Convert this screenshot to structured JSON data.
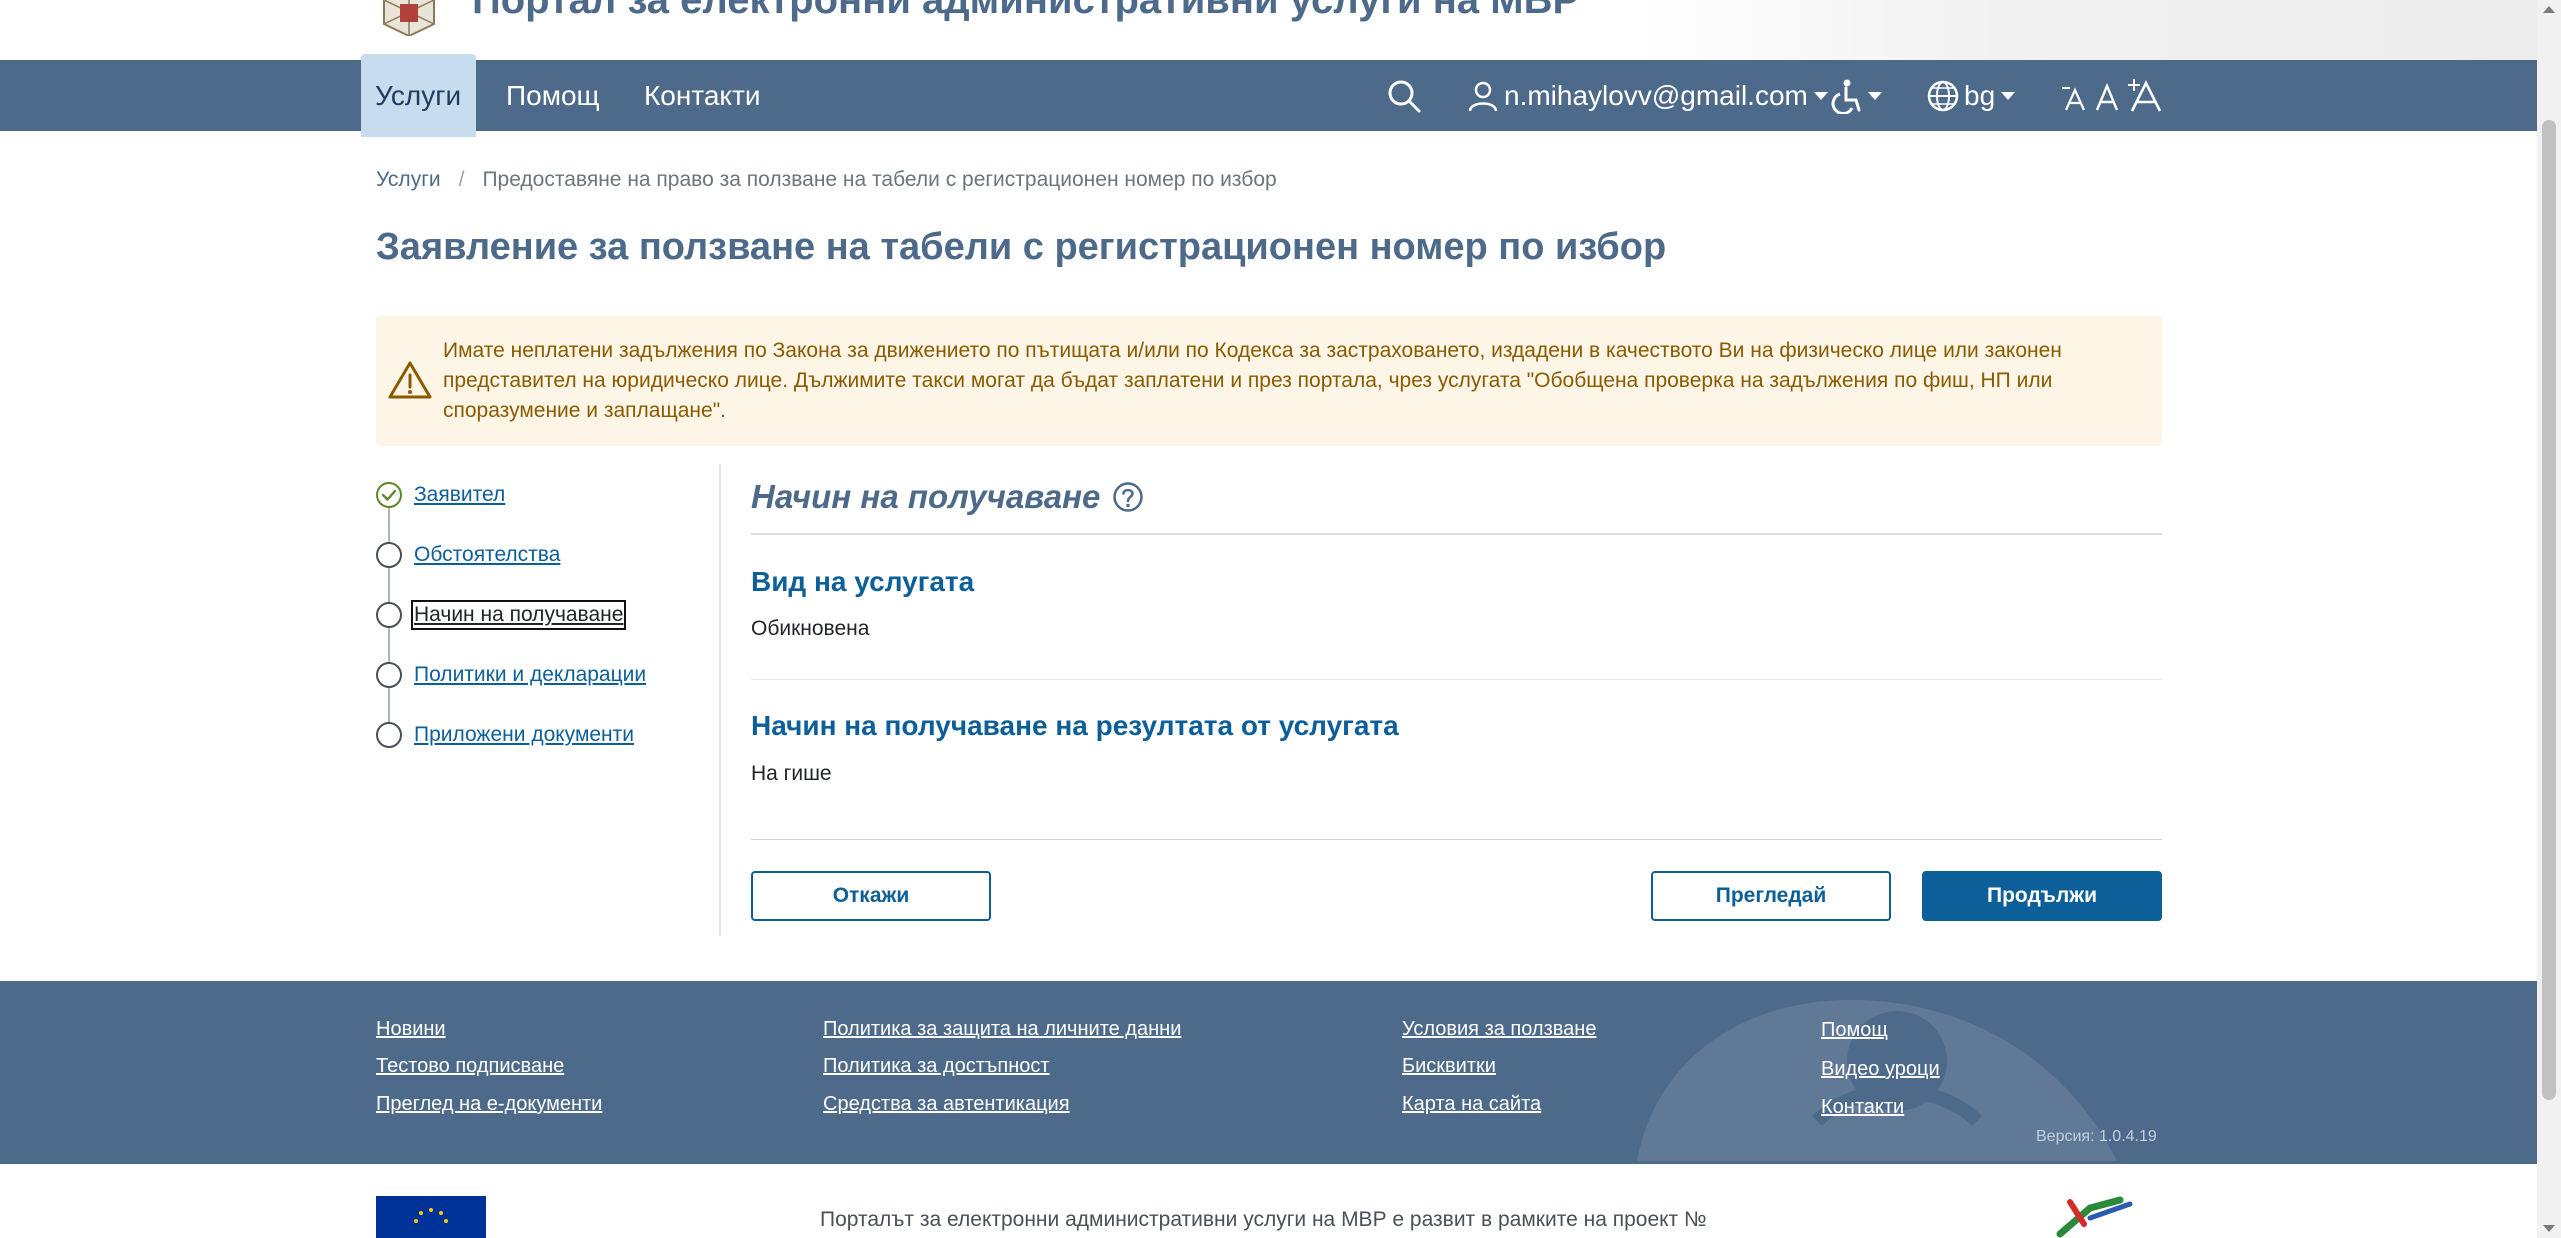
{
  "header": {
    "portal_title": "Портал за електронни административни услуги на МВР"
  },
  "nav": {
    "items": [
      {
        "label": "Услуги",
        "active": true
      },
      {
        "label": "Помощ",
        "active": false
      },
      {
        "label": "Контакти",
        "active": false
      }
    ],
    "user_email": "n.mihaylovv@gmail.com",
    "language": "bg",
    "icons": [
      "search-icon",
      "user-icon",
      "accessibility-icon",
      "globe-icon",
      "font-decrease-icon",
      "font-normal-icon",
      "font-increase-icon"
    ]
  },
  "breadcrumb": {
    "root": "Услуги",
    "separator": "/",
    "current": "Предоставяне на право за ползване на табели с регистрационен номер по избор"
  },
  "page": {
    "title": "Заявление за ползване на табели с регистрационен номер по избор"
  },
  "alert": {
    "text": "Имате неплатени задължения по Закона за движението по пътищата и/или по Кодекса за застраховането, издадени в качеството Ви на физическо лице или законен представител на юридическо лице. Дължимите такси могат да бъдат заплатени и през портала, чрез услугата \"Обобщена проверка на задължения по фиш, НП или споразумение и заплащане\".",
    "icon": "warning-icon",
    "color": "#8a5a00",
    "background": "#fdf5e6"
  },
  "steps": [
    {
      "label": "Заявител",
      "state": "done"
    },
    {
      "label": "Обстоятелства",
      "state": "pending"
    },
    {
      "label": "Начин на получаване",
      "state": "current"
    },
    {
      "label": "Политики и декларации",
      "state": "pending"
    },
    {
      "label": "Приложени документи",
      "state": "pending"
    }
  ],
  "form": {
    "section_title": "Начин на получаване",
    "service_type": {
      "label": "Вид на услугата",
      "value": "Обикновена"
    },
    "delivery": {
      "label": "Начин на получаване на резултата от услугата",
      "value": "На гише"
    },
    "buttons": {
      "cancel": "Откажи",
      "preview": "Прегледай",
      "continue": "Продължи"
    }
  },
  "footer": {
    "col1": [
      "Новини",
      "Тестово подписване",
      "Преглед на е-документи"
    ],
    "col2": [
      "Политика за защита на личните данни",
      "Политика за достъпност",
      "Средства за автентикация"
    ],
    "col3": [
      "Условия за ползване",
      "Бисквитки",
      "Карта на сайта"
    ],
    "col4": [
      "Помощ",
      "Видео уроци",
      "Контакти"
    ],
    "version": "Версия: 1.0.4.19",
    "project_text": "Порталът за електронни административни услуги на МВР е развит в рамките на проект №"
  },
  "colors": {
    "nav_bg": "#4d6a8a",
    "active_tab_bg": "#c8dcef",
    "primary": "#0d5f99",
    "title": "#4d6a8a"
  }
}
